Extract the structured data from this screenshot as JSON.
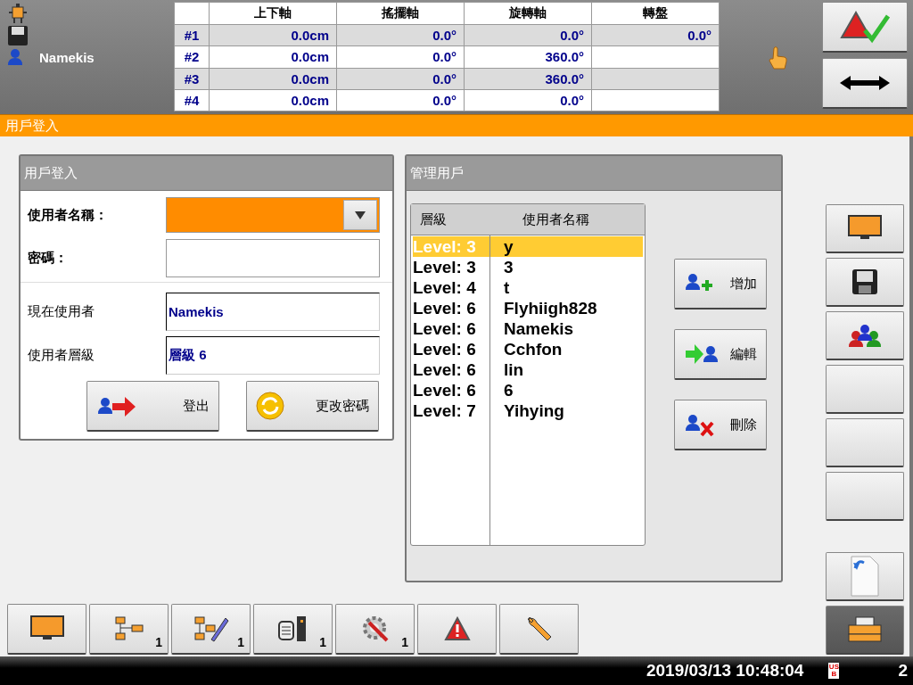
{
  "header": {
    "user": "Namekis"
  },
  "axis_table": {
    "columns": [
      "上下軸",
      "搖擺軸",
      "旋轉軸",
      "轉盤"
    ],
    "rows": [
      {
        "label": "#1",
        "cells": [
          "0.0cm",
          "0.0°",
          "0.0°",
          "0.0°"
        ]
      },
      {
        "label": "#2",
        "cells": [
          "0.0cm",
          "0.0°",
          "360.0°"
        ]
      },
      {
        "label": "#3",
        "cells": [
          "0.0cm",
          "0.0°",
          "360.0°"
        ]
      },
      {
        "label": "#4",
        "cells": [
          "0.0cm",
          "0.0°",
          "0.0°"
        ]
      }
    ]
  },
  "page_title": "用戶登入",
  "login_panel": {
    "title": "用戶登入",
    "fields": [
      {
        "label": "使用者名稱：",
        "kind": "dropdown"
      },
      {
        "label": "密碼：",
        "kind": "password"
      }
    ],
    "info": [
      {
        "label": "現在使用者",
        "value": "Namekis"
      },
      {
        "label": "使用者層級",
        "value": "層級 6"
      }
    ],
    "buttons": [
      {
        "label": "登出",
        "kind": "logout"
      },
      {
        "label": "更改密碼",
        "kind": "refresh"
      }
    ]
  },
  "manage_panel": {
    "title": "管理用戶",
    "columns": [
      "層級",
      "使用者名稱"
    ],
    "users": [
      {
        "level": "Level: 3",
        "name": "y",
        "selected": true
      },
      {
        "level": "Level: 3",
        "name": "3",
        "selected": false
      },
      {
        "level": "Level: 4",
        "name": "t",
        "selected": false
      },
      {
        "level": "Level: 6",
        "name": "Flyhiigh828",
        "selected": false
      },
      {
        "level": "Level: 6",
        "name": "Namekis",
        "selected": false
      },
      {
        "level": "Level: 6",
        "name": "Cchfon",
        "selected": false
      },
      {
        "level": "Level: 6",
        "name": "lin",
        "selected": false
      },
      {
        "level": "Level: 6",
        "name": "6",
        "selected": false
      },
      {
        "level": "Level: 7",
        "name": "Yihying",
        "selected": false
      }
    ],
    "buttons": [
      {
        "label": "增加",
        "kind": "add"
      },
      {
        "label": "編輯",
        "kind": "edit"
      },
      {
        "label": "刪除",
        "kind": "delete"
      }
    ]
  },
  "side_buttons": [
    {
      "kind": "monitor",
      "selected": false
    },
    {
      "kind": "save",
      "selected": false
    },
    {
      "kind": "users",
      "selected": false
    },
    {
      "kind": "empty",
      "selected": false
    },
    {
      "kind": "empty",
      "selected": false
    },
    {
      "kind": "empty",
      "selected": false
    },
    {
      "kind": "undo",
      "selected": false
    },
    {
      "kind": "printer",
      "selected": true
    }
  ],
  "bottom_toolbar": [
    {
      "kind": "monitor"
    },
    {
      "kind": "tree",
      "count": "1"
    },
    {
      "kind": "tree-edit",
      "count": "1"
    },
    {
      "kind": "drive",
      "count": "1"
    },
    {
      "kind": "gear",
      "count": "1"
    },
    {
      "kind": "alarm"
    },
    {
      "kind": "wrench"
    }
  ],
  "status_bar": {
    "datetime": "2019/03/13 10:48:04",
    "usb": "USB",
    "count": "2"
  }
}
